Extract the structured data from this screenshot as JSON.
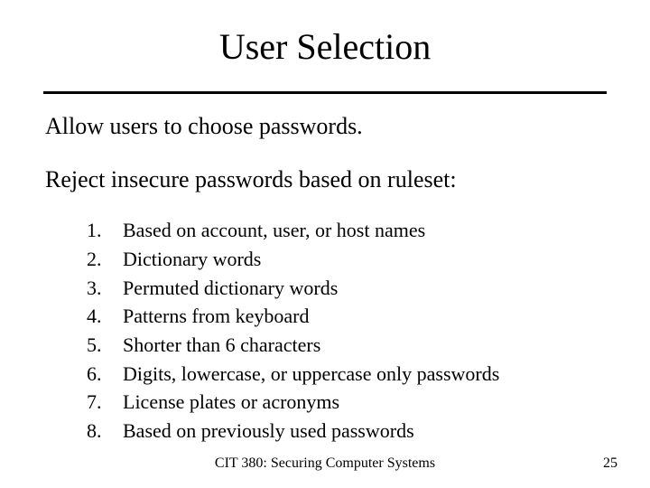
{
  "title": "User Selection",
  "paragraph1": "Allow users to choose passwords.",
  "paragraph2": "Reject insecure passwords based on ruleset:",
  "rules": [
    "Based on account, user, or host names",
    "Dictionary words",
    "Permuted dictionary words",
    "Patterns from keyboard",
    "Shorter than 6 characters",
    "Digits, lowercase, or uppercase only passwords",
    "License plates or acronyms",
    "Based on previously used passwords"
  ],
  "footer": "CIT 380: Securing Computer Systems",
  "page_number": "25"
}
